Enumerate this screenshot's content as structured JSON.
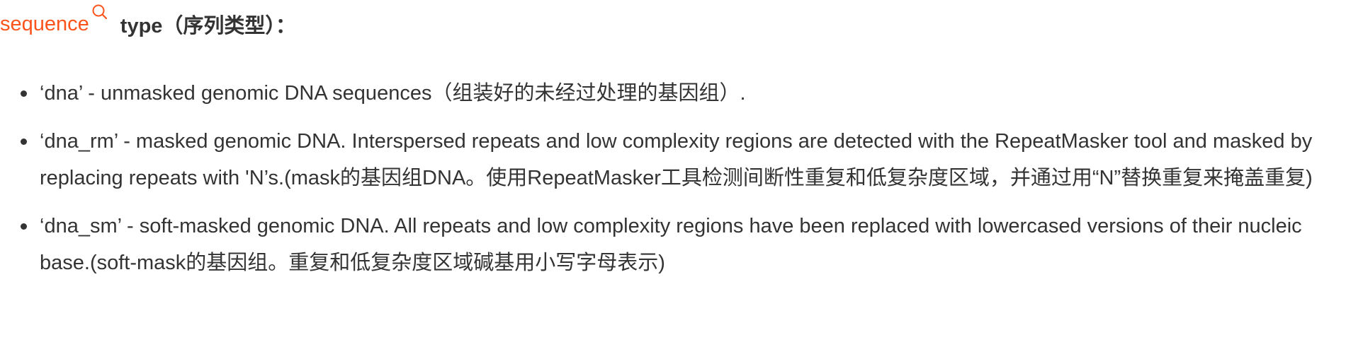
{
  "heading": {
    "link_text": "sequence",
    "link_icon": "search-icon",
    "rest_text": "type（序列类型）：",
    "link_color": "#fa541c"
  },
  "items": [
    {
      "text": "‘dna’ - unmasked genomic DNA sequences（组装好的未经过处理的基因组）."
    },
    {
      "text": "‘dna_rm’ - masked genomic DNA. Interspersed repeats and low complexity regions are detected with the RepeatMasker tool and masked by replacing repeats with 'N’s.(mask的基因组DNA。使用RepeatMasker工具检测间断性重复和低复杂度区域，并通过用“N”替换重复来掩盖重复)"
    },
    {
      "text": "‘dna_sm’ - soft-masked genomic DNA. All repeats and low complexity regions have been replaced with lowercased versions of their nucleic base.(soft-mask的基因组。重复和低复杂度区域碱基用小写字母表示)"
    }
  ]
}
